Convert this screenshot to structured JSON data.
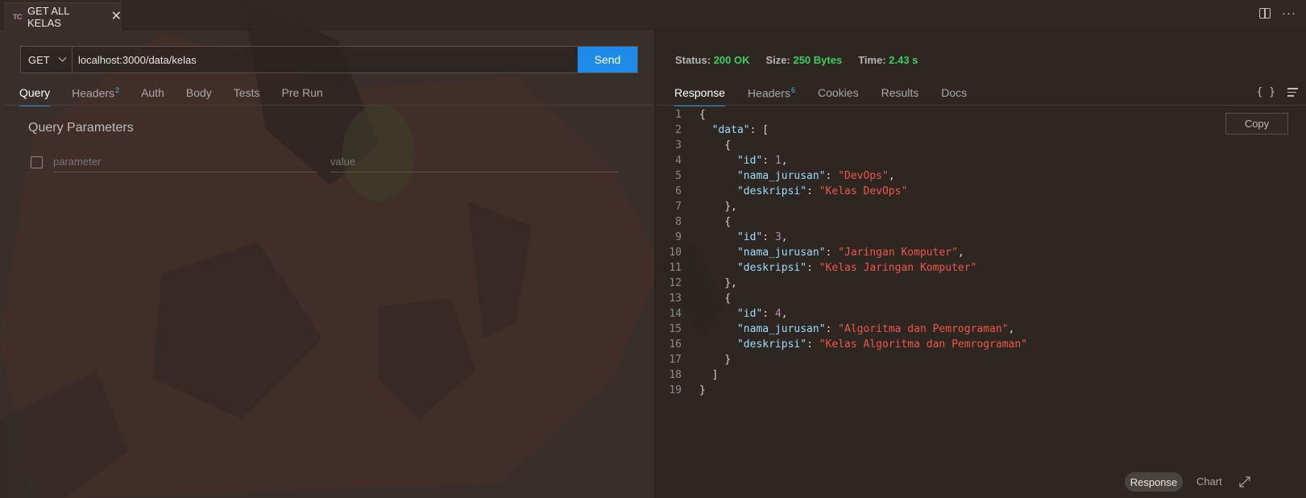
{
  "tab": {
    "badge": "TC",
    "title": "GET ALL KELAS",
    "close": "✕"
  },
  "request": {
    "method": "GET",
    "url": "localhost:3000/data/kelas",
    "send_label": "Send",
    "tabs": [
      {
        "label": "Query",
        "count": ""
      },
      {
        "label": "Headers",
        "count": "2"
      },
      {
        "label": "Auth",
        "count": ""
      },
      {
        "label": "Body",
        "count": ""
      },
      {
        "label": "Tests",
        "count": ""
      },
      {
        "label": "Pre Run",
        "count": ""
      }
    ],
    "query_title": "Query Parameters",
    "param_placeholder": "parameter",
    "value_placeholder": "value"
  },
  "response": {
    "status_label": "Status:",
    "status_value": "200 OK",
    "size_label": "Size:",
    "size_value": "250 Bytes",
    "time_label": "Time:",
    "time_value": "2.43 s",
    "tabs": [
      {
        "label": "Response",
        "count": ""
      },
      {
        "label": "Headers",
        "count": "6"
      },
      {
        "label": "Cookies",
        "count": ""
      },
      {
        "label": "Results",
        "count": ""
      },
      {
        "label": "Docs",
        "count": ""
      }
    ],
    "format_icon": "{ }",
    "copy_label": "Copy",
    "body_lines": [
      {
        "n": "1",
        "indent": 0,
        "parts": [
          {
            "t": "p",
            "v": "{"
          }
        ]
      },
      {
        "n": "2",
        "indent": 1,
        "parts": [
          {
            "t": "k",
            "v": "\"data\""
          },
          {
            "t": "p",
            "v": ": ["
          }
        ]
      },
      {
        "n": "3",
        "indent": 2,
        "parts": [
          {
            "t": "p",
            "v": "{"
          }
        ]
      },
      {
        "n": "4",
        "indent": 3,
        "parts": [
          {
            "t": "k",
            "v": "\"id\""
          },
          {
            "t": "p",
            "v": ": "
          },
          {
            "t": "n",
            "v": "1"
          },
          {
            "t": "p",
            "v": ","
          }
        ]
      },
      {
        "n": "5",
        "indent": 3,
        "parts": [
          {
            "t": "k",
            "v": "\"nama_jurusan\""
          },
          {
            "t": "p",
            "v": ": "
          },
          {
            "t": "s",
            "v": "\"DevOps\""
          },
          {
            "t": "p",
            "v": ","
          }
        ]
      },
      {
        "n": "6",
        "indent": 3,
        "parts": [
          {
            "t": "k",
            "v": "\"deskripsi\""
          },
          {
            "t": "p",
            "v": ": "
          },
          {
            "t": "s",
            "v": "\"Kelas DevOps\""
          }
        ]
      },
      {
        "n": "7",
        "indent": 2,
        "parts": [
          {
            "t": "p",
            "v": "},"
          }
        ]
      },
      {
        "n": "8",
        "indent": 2,
        "parts": [
          {
            "t": "p",
            "v": "{"
          }
        ]
      },
      {
        "n": "9",
        "indent": 3,
        "parts": [
          {
            "t": "k",
            "v": "\"id\""
          },
          {
            "t": "p",
            "v": ": "
          },
          {
            "t": "n",
            "v": "3"
          },
          {
            "t": "p",
            "v": ","
          }
        ]
      },
      {
        "n": "10",
        "indent": 3,
        "parts": [
          {
            "t": "k",
            "v": "\"nama_jurusan\""
          },
          {
            "t": "p",
            "v": ": "
          },
          {
            "t": "s",
            "v": "\"Jaringan Komputer\""
          },
          {
            "t": "p",
            "v": ","
          }
        ]
      },
      {
        "n": "11",
        "indent": 3,
        "parts": [
          {
            "t": "k",
            "v": "\"deskripsi\""
          },
          {
            "t": "p",
            "v": ": "
          },
          {
            "t": "s",
            "v": "\"Kelas Jaringan Komputer\""
          }
        ]
      },
      {
        "n": "12",
        "indent": 2,
        "parts": [
          {
            "t": "p",
            "v": "},"
          }
        ]
      },
      {
        "n": "13",
        "indent": 2,
        "parts": [
          {
            "t": "p",
            "v": "{"
          }
        ]
      },
      {
        "n": "14",
        "indent": 3,
        "parts": [
          {
            "t": "k",
            "v": "\"id\""
          },
          {
            "t": "p",
            "v": ": "
          },
          {
            "t": "n",
            "v": "4"
          },
          {
            "t": "p",
            "v": ","
          }
        ]
      },
      {
        "n": "15",
        "indent": 3,
        "parts": [
          {
            "t": "k",
            "v": "\"nama_jurusan\""
          },
          {
            "t": "p",
            "v": ": "
          },
          {
            "t": "s",
            "v": "\"Algoritma dan Pemrograman\""
          },
          {
            "t": "p",
            "v": ","
          }
        ]
      },
      {
        "n": "16",
        "indent": 3,
        "parts": [
          {
            "t": "k",
            "v": "\"deskripsi\""
          },
          {
            "t": "p",
            "v": ": "
          },
          {
            "t": "s",
            "v": "\"Kelas Algoritma dan Pemrograman\""
          }
        ]
      },
      {
        "n": "17",
        "indent": 2,
        "parts": [
          {
            "t": "p",
            "v": "}"
          }
        ]
      },
      {
        "n": "18",
        "indent": 1,
        "parts": [
          {
            "t": "p",
            "v": "]"
          }
        ]
      },
      {
        "n": "19",
        "indent": 0,
        "parts": [
          {
            "t": "p",
            "v": "}"
          }
        ]
      }
    ],
    "bottom_response_label": "Response",
    "bottom_chart_label": "Chart"
  },
  "colors": {
    "accent": "#1f8be8",
    "status_ok": "#3ecf5e",
    "json_key": "#9cdcfe",
    "json_string": "#f0564a",
    "json_number": "#b48ead"
  }
}
